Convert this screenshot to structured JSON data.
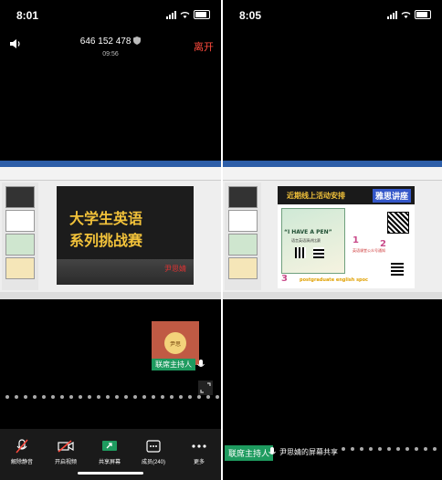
{
  "left": {
    "status_time": "8:01",
    "meeting_id": "646 152 478",
    "duration": "09:56",
    "leave_label": "离开",
    "slide": {
      "line1": "大学生英语",
      "line2": "系列挑战赛",
      "presenter": "尹思婧"
    },
    "participant": {
      "avatar_text": "尹思",
      "host_label": "联席主持人"
    },
    "toolbar": [
      {
        "label": "解除静音",
        "icon": "mic-muted-icon"
      },
      {
        "label": "开启视频",
        "icon": "video-off-icon"
      },
      {
        "label": "共享屏幕",
        "icon": "share-screen-icon"
      },
      {
        "label": "成员(240)",
        "icon": "members-icon"
      },
      {
        "label": "更多",
        "icon": "more-icon"
      }
    ]
  },
  "right": {
    "status_time": "8:05",
    "slide": {
      "heading": "近期线上活动安排",
      "badge": "雅思讲座",
      "event_title": "“I HAVE A PEN”",
      "event_subtitle": "语言英语演讲比赛",
      "number1": "1",
      "number2": "2",
      "number3": "3",
      "postgrad": "postgraduate english spoc",
      "qr_note": "英语课堂公众号通知"
    },
    "host_label": "联席主持人",
    "sharing_label": "尹思婧的屏幕共享"
  },
  "colors": {
    "accent_red": "#ff4a3d",
    "host_green": "#1e9b5f",
    "slide_gold": "#f2c23a"
  }
}
